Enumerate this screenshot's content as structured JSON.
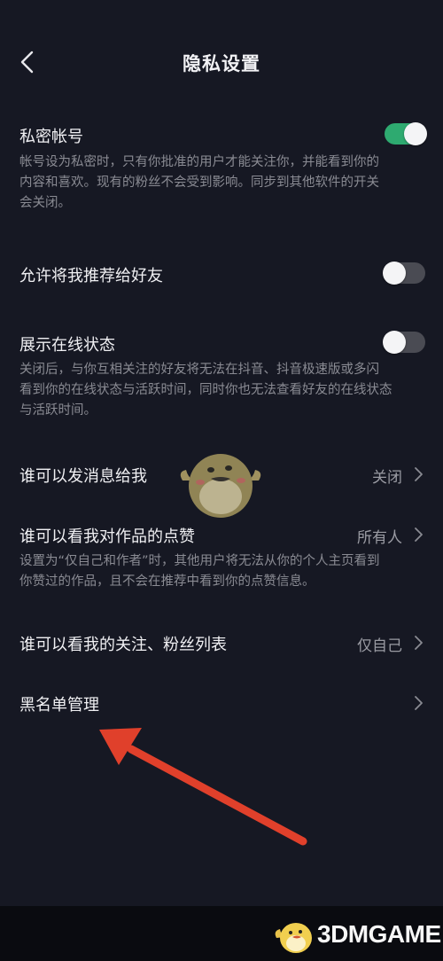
{
  "header": {
    "title": "隐私设置",
    "back_icon": "chevron-left-icon"
  },
  "colors": {
    "background": "#161823",
    "toggle_on": "#2eaa70",
    "toggle_off": "#4a4b53",
    "arrow": "#e0402b"
  },
  "settings": {
    "private_account": {
      "title": "私密帐号",
      "desc_lines": [
        "帐号设为私密时，只有你批准的用户才能关注你，并能看到你的",
        "内容和喜欢。现有的粉丝不会受到影响。同步到其他软件的开关",
        "会关闭。"
      ],
      "enabled": true
    },
    "recommend_to_friends": {
      "title": "允许将我推荐给好友",
      "enabled": false
    },
    "online_status": {
      "title": "展示在线状态",
      "desc_lines": [
        "关闭后，与你互相关注的好友将无法在抖音、抖音极速版或多闪",
        "看到你的在线状态与活跃时间，同时你也无法查看好友的在线状态",
        "与活跃时间。"
      ],
      "enabled": false
    },
    "who_can_message": {
      "title": "谁可以发消息给我",
      "value": "关闭"
    },
    "who_can_see_likes": {
      "title": "谁可以看我对作品的点赞",
      "value": "所有人",
      "desc_lines": [
        "设置为“仅自己和作者”时，其他用户将无法从你的个人主页看到",
        "你赞过的作品，且不会在推荐中看到你的点赞信息。"
      ]
    },
    "who_can_see_follow_lists": {
      "title": "谁可以看我的关注、粉丝列表",
      "value": "仅自己"
    },
    "blacklist": {
      "title": "黑名单管理"
    }
  },
  "watermark": {
    "text": "3DMGAME"
  }
}
